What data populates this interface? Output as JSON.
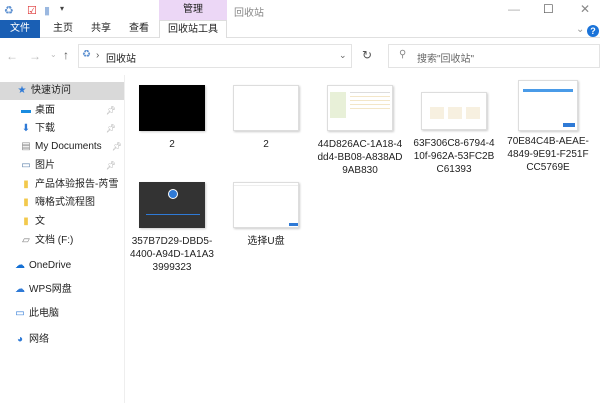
{
  "window": {
    "title": "回收站",
    "context_tab": "管理",
    "minimize": "—",
    "maximize": "☐",
    "close": "✕"
  },
  "ribbon": {
    "tabs": [
      "文件",
      "主页",
      "共享",
      "查看",
      "回收站工具"
    ],
    "collapse": "⌄",
    "help": "?"
  },
  "address": {
    "path": "回收站",
    "search_placeholder": "搜索\"回收站\""
  },
  "nav": {
    "items": [
      {
        "label": "快速访问",
        "icon": "star-icon"
      },
      {
        "label": "桌面",
        "icon": "desktop-icon",
        "pinned": true
      },
      {
        "label": "下载",
        "icon": "download-icon",
        "pinned": true
      },
      {
        "label": "My Documents",
        "icon": "document-icon",
        "pinned": true
      },
      {
        "label": "图片",
        "icon": "pictures-icon",
        "pinned": true
      },
      {
        "label": "产品体验报告-芮雪",
        "icon": "folder-icon"
      },
      {
        "label": "嗨格式流程图",
        "icon": "folder-icon"
      },
      {
        "label": "文",
        "icon": "folder-icon"
      },
      {
        "label": "文档 (F:)",
        "icon": "drive-icon"
      },
      {
        "label": "OneDrive",
        "icon": "cloud-icon"
      },
      {
        "label": "WPS网盘",
        "icon": "cloud-outline-icon"
      },
      {
        "label": "此电脑",
        "icon": "computer-icon"
      },
      {
        "label": "网络",
        "icon": "network-icon"
      }
    ]
  },
  "files": [
    {
      "name": "2",
      "thumb": "black"
    },
    {
      "name": "2",
      "thumb": "white"
    },
    {
      "name": "44D826AC-1A18-4dd4-BB08-A838AD9AB830",
      "thumb": "explorer"
    },
    {
      "name": "63F306C8-6794-410f-962A-53FC2BC61393",
      "thumb": "cards"
    },
    {
      "name": "70E84C4B-AEAE-4849-9E91-F251FCC5769E",
      "thumb": "dialog"
    },
    {
      "name": "357B7D29-DBD5-4400-A94D-1A1A33999323",
      "thumb": "dark"
    },
    {
      "name": "选择U盘",
      "thumb": "app"
    }
  ]
}
